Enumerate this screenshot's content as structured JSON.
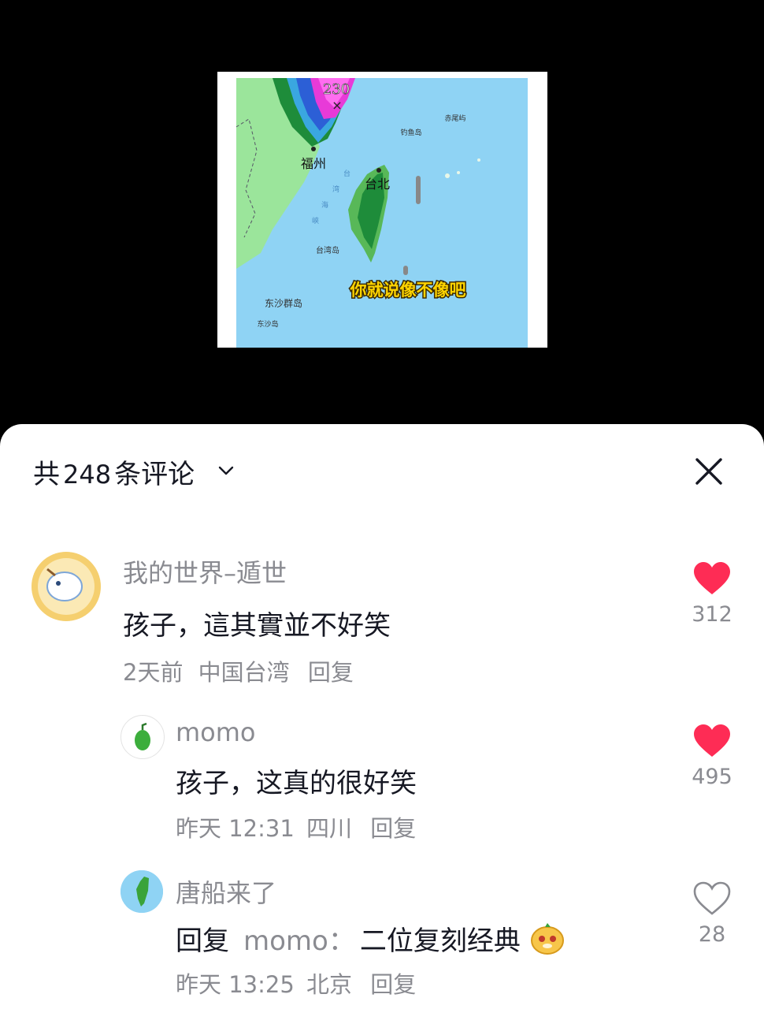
{
  "video": {
    "caption": "你就说像不像吧",
    "map_labels": {
      "wind": "230",
      "fuzhou": "福州",
      "taipei": "台北",
      "diaoyu": "钓鱼岛",
      "chiwei": "赤尾屿",
      "strait_1": "台",
      "strait_2": "湾",
      "strait_3": "海",
      "strait_4": "峡",
      "taiwan_island": "台湾岛",
      "dongsha_islands": "东沙群岛",
      "dongsha": "东沙岛"
    }
  },
  "comments_panel": {
    "title_prefix": "共",
    "count": "248",
    "title_suffix": "条评论",
    "comments": [
      {
        "user": "我的世界–遁世",
        "text": "孩子，這其實並不好笑",
        "time": "2天前",
        "location": "中国台湾",
        "reply_label": "回复",
        "likes": "312",
        "liked": true
      },
      {
        "user": "momo",
        "text": "孩子，这真的很好笑",
        "time": "昨天 12:31",
        "location": "四川",
        "reply_label": "回复",
        "likes": "495",
        "liked": true
      },
      {
        "user": "唐船来了",
        "text_prefix": "回复",
        "reply_to": "momo：",
        "text": "二位复刻经典",
        "time": "昨天 13:25",
        "location": "北京",
        "reply_label": "回复",
        "likes": "28",
        "liked": false
      }
    ]
  },
  "colors": {
    "like_active": "#fe2c55",
    "sea": "#8fd3f4",
    "land": "#9be59b"
  }
}
